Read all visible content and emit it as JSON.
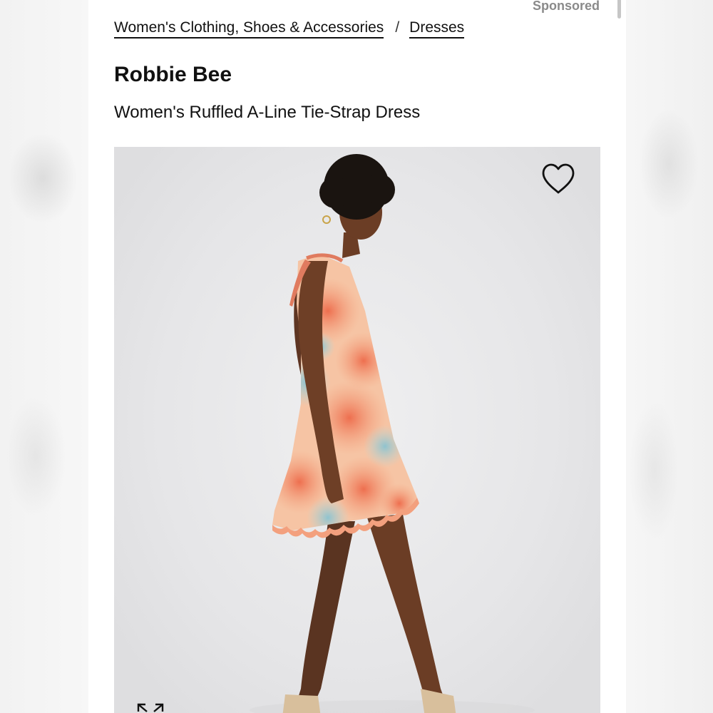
{
  "sponsored_label": "Sponsored",
  "breadcrumb": {
    "items": [
      {
        "label": "Women's Clothing, Shoes & Accessories"
      },
      {
        "label": "Dresses"
      }
    ],
    "separator": "/"
  },
  "product": {
    "brand": "Robbie Bee",
    "name": "Women's Ruffled A-Line Tie-Strap Dress"
  },
  "gallery": {
    "favorite_icon": "heart-outline-icon",
    "expand_icon": "expand-arrows-icon",
    "image_subject": "product-photo"
  },
  "colors": {
    "text": "#111111",
    "muted": "#8a8a8a",
    "image_bg": "#e8e8ea",
    "dress_coral": "#f08a6a",
    "dress_peach": "#f6c4a4"
  }
}
